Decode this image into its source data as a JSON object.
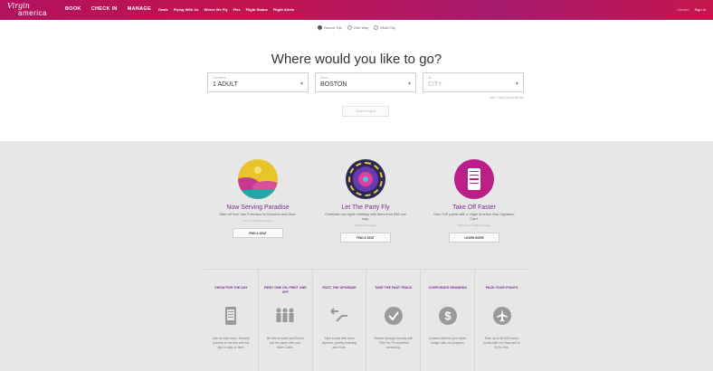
{
  "brand": {
    "script": "Virgin",
    "word": "america"
  },
  "nav": {
    "main": [
      "BOOK",
      "CHECK IN",
      "MANAGE"
    ],
    "sub": [
      "Deals",
      "Flying With Us",
      "Where We Fly",
      "Flex",
      "Flight Status",
      "Flight Alerts"
    ],
    "right": {
      "elevate": "elevate",
      "signin": "Sign In"
    }
  },
  "trip_types": [
    {
      "label": "Round Trip",
      "selected": true
    },
    {
      "label": "One Way",
      "selected": false
    },
    {
      "label": "Multi City",
      "selected": false
    }
  ],
  "headline": "Where would you like to go?",
  "fields": {
    "travelers": {
      "label": "Travelers",
      "value": "1 ADULT"
    },
    "from": {
      "label": "From",
      "value": "BOSTON"
    },
    "to": {
      "label": "To",
      "placeholder": "CITY"
    }
  },
  "hint": "New: Every Airport Airlines",
  "find_button": "Search Flights",
  "promos": [
    {
      "title": "Now Serving Paradise",
      "desc": "Take off from San Francisco to Honolulu and Maui.",
      "more": "Terms & conditions apply.",
      "button": "FIND A SEAT"
    },
    {
      "title": "Let The Party Fly",
      "desc": "Celebrate our eighth birthday with fares from $38 one way.",
      "more": "Restrictions apply.",
      "button": "FIND A SEAT"
    },
    {
      "title": "Take Off Faster",
      "desc": "Earn 10K points with a Virgin America Visa Signature Card.",
      "more": "Terms and conditions apply.",
      "button": "LEARN MORE"
    }
  ],
  "perks": [
    {
      "title": "SHOW FOR THE DAY",
      "icon": "phone-icon",
      "desc": "Use an Acre seat / Security preview to the line with the app to stay on time!"
    },
    {
      "title": "FIRST ONE ON, FIRST ONE OFF",
      "icon": "people-icon",
      "desc": "Be first to board and first to exit the plane with your Main Cabin."
    },
    {
      "title": "PSST, THE UPGRADE",
      "icon": "arrow-icon",
      "desc": "Take a seat with extra legroom, priority boarding and more."
    },
    {
      "title": "TAKE THE FAST TRACK",
      "icon": "check-icon",
      "desc": "Breeze through security with TSA Pre✓® expedited screening."
    },
    {
      "title": "CORPORATE REWARDS",
      "icon": "dollar-icon",
      "desc": "A sweet deal for your travel budget with our program."
    },
    {
      "title": "PACK YOUR POINTS",
      "icon": "plane-icon",
      "desc": "Earn up to 50,000 bonus points with our Visa card to fly for free."
    }
  ]
}
